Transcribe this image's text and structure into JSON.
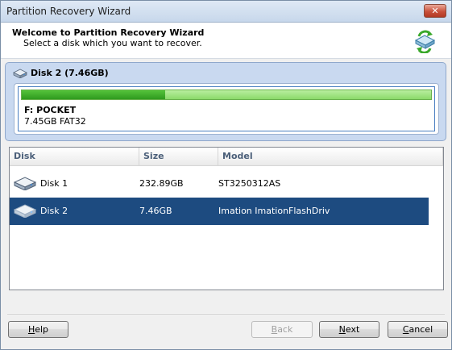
{
  "window": {
    "title": "Partition Recovery Wizard",
    "close_label": "✕"
  },
  "header": {
    "title": "Welcome to Partition Recovery Wizard",
    "subtitle": "Select a disk which you want to recover."
  },
  "selected_disk": {
    "label": "Disk 2 (7.46GB)",
    "partition": {
      "name": "F: POCKET",
      "info": "7.45GB FAT32",
      "used_fraction": 0.35
    }
  },
  "disk_list": {
    "columns": [
      "Disk",
      "Size",
      "Model"
    ],
    "rows": [
      {
        "disk": "Disk 1",
        "size": "232.89GB",
        "model": "ST3250312AS",
        "selected": false
      },
      {
        "disk": "Disk 2",
        "size": "7.46GB",
        "model": "Imation ImationFlashDriv",
        "selected": true
      }
    ]
  },
  "buttons": {
    "help": {
      "key": "H",
      "rest": "elp",
      "enabled": true
    },
    "back": {
      "key": "B",
      "rest": "ack",
      "enabled": false
    },
    "next": {
      "key": "N",
      "rest": "ext",
      "enabled": true
    },
    "cancel": {
      "key": "C",
      "rest": "ancel",
      "enabled": true
    }
  },
  "colors": {
    "selection": "#1d4b80",
    "usage_used": "#2f9a1e",
    "usage_free": "#8bd96a"
  },
  "icons": {
    "wizard": "disk-recovery-icon",
    "disk": "hard-disk-icon"
  }
}
